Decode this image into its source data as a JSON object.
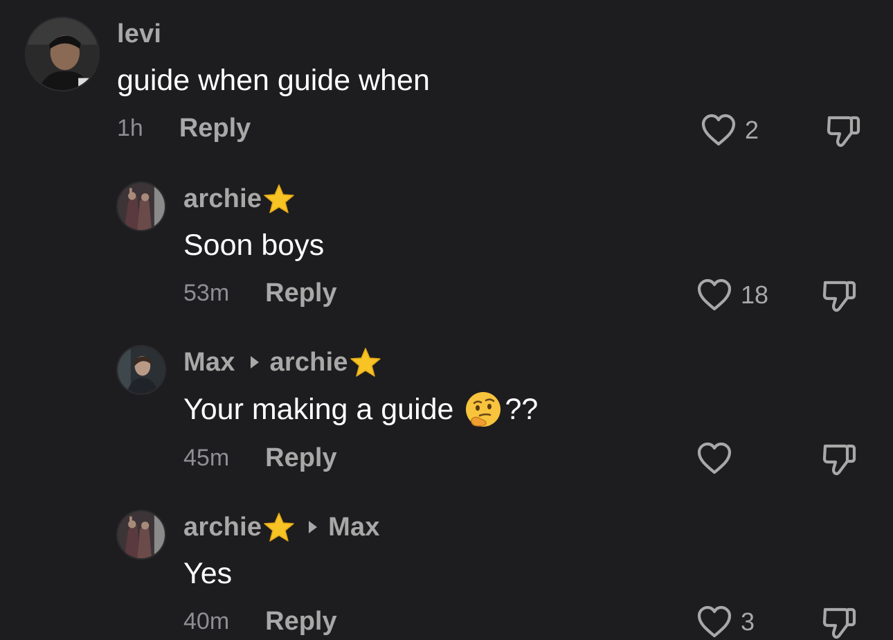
{
  "comments": [
    {
      "username": "levi",
      "text": "guide when guide when",
      "time": "1h",
      "reply_label": "Reply",
      "likes": "2"
    },
    {
      "username": "archie",
      "text": "Soon boys",
      "time": "53m",
      "reply_label": "Reply",
      "likes": "18"
    },
    {
      "username": "Max",
      "reply_to": "archie",
      "text": "Your making a guide",
      "text_suffix": "??",
      "time": "45m",
      "reply_label": "Reply",
      "likes": ""
    },
    {
      "username": "archie",
      "reply_to": "Max",
      "text": "Yes",
      "time": "40m",
      "reply_label": "Reply",
      "likes": "3"
    }
  ],
  "icons": {
    "like": "heart-outline-icon",
    "dislike": "thumbs-down-icon",
    "badge": "star-emoji",
    "emoji": "thinking-face-emoji",
    "reply_arrow": "triangle-right-icon"
  },
  "colors": {
    "background": "#1d1d1f",
    "username": "#a8a8a8",
    "body_text": "#ffffff",
    "meta": "#8e8e93"
  }
}
